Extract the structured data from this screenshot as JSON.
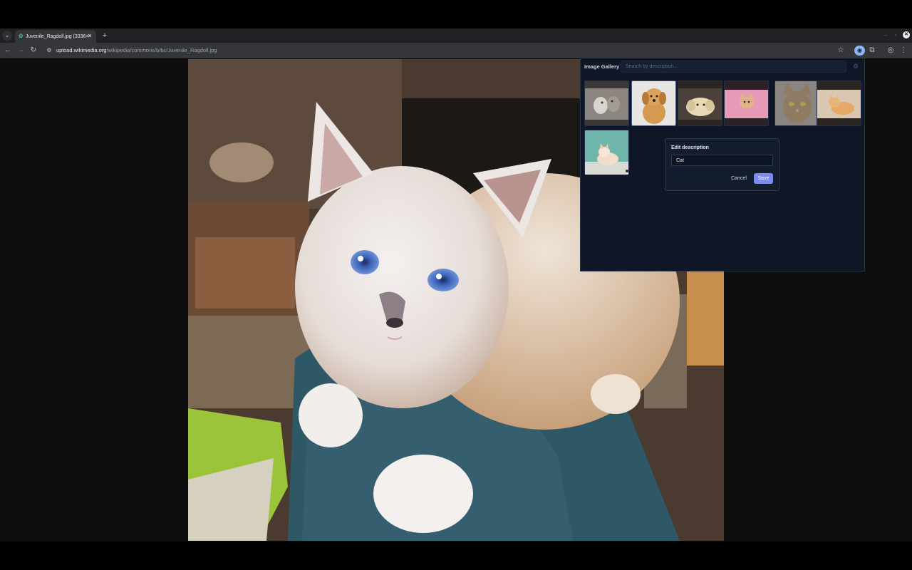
{
  "browser": {
    "tab_search_icon": "chevron-down-icon",
    "tab": {
      "favicon": "wikimedia-favicon",
      "title": "Juvenile_Ragdoll.jpg (3336×",
      "close_icon": "close-icon"
    },
    "new_tab_icon": "plus-icon",
    "url_host": "upload.wikimedia.org",
    "url_path": "/wikipedia/commons/b/bc/Juvenile_Ragdoll.jpg",
    "icons": [
      "back-icon",
      "forward-icon",
      "reload-icon",
      "site-info-icon",
      "star-icon",
      "extension-active-icon",
      "puzzle-icon",
      "profile-icon",
      "menu-icon"
    ]
  },
  "page": {
    "image_subject": "white ragdoll kitten with blue eyes"
  },
  "gallery": {
    "title": "Image Gallery",
    "search_placeholder": "Search by description...",
    "settings_icon": "gear-icon",
    "thumbnails": [
      {
        "label": "kittens"
      },
      {
        "label": "golden puppy"
      },
      {
        "label": "lab puppy"
      },
      {
        "label": "kitten in pink blanket"
      },
      {
        "label": "tabby cat"
      },
      {
        "label": "orange kitten"
      },
      {
        "label": "white kitten"
      }
    ]
  },
  "edit_dialog": {
    "title": "Edit description",
    "value": "Cat",
    "cancel_label": "Cancel",
    "save_label": "Save"
  },
  "colors": {
    "accent": "#7b8cf0",
    "panel_bg": "#0f1726"
  }
}
